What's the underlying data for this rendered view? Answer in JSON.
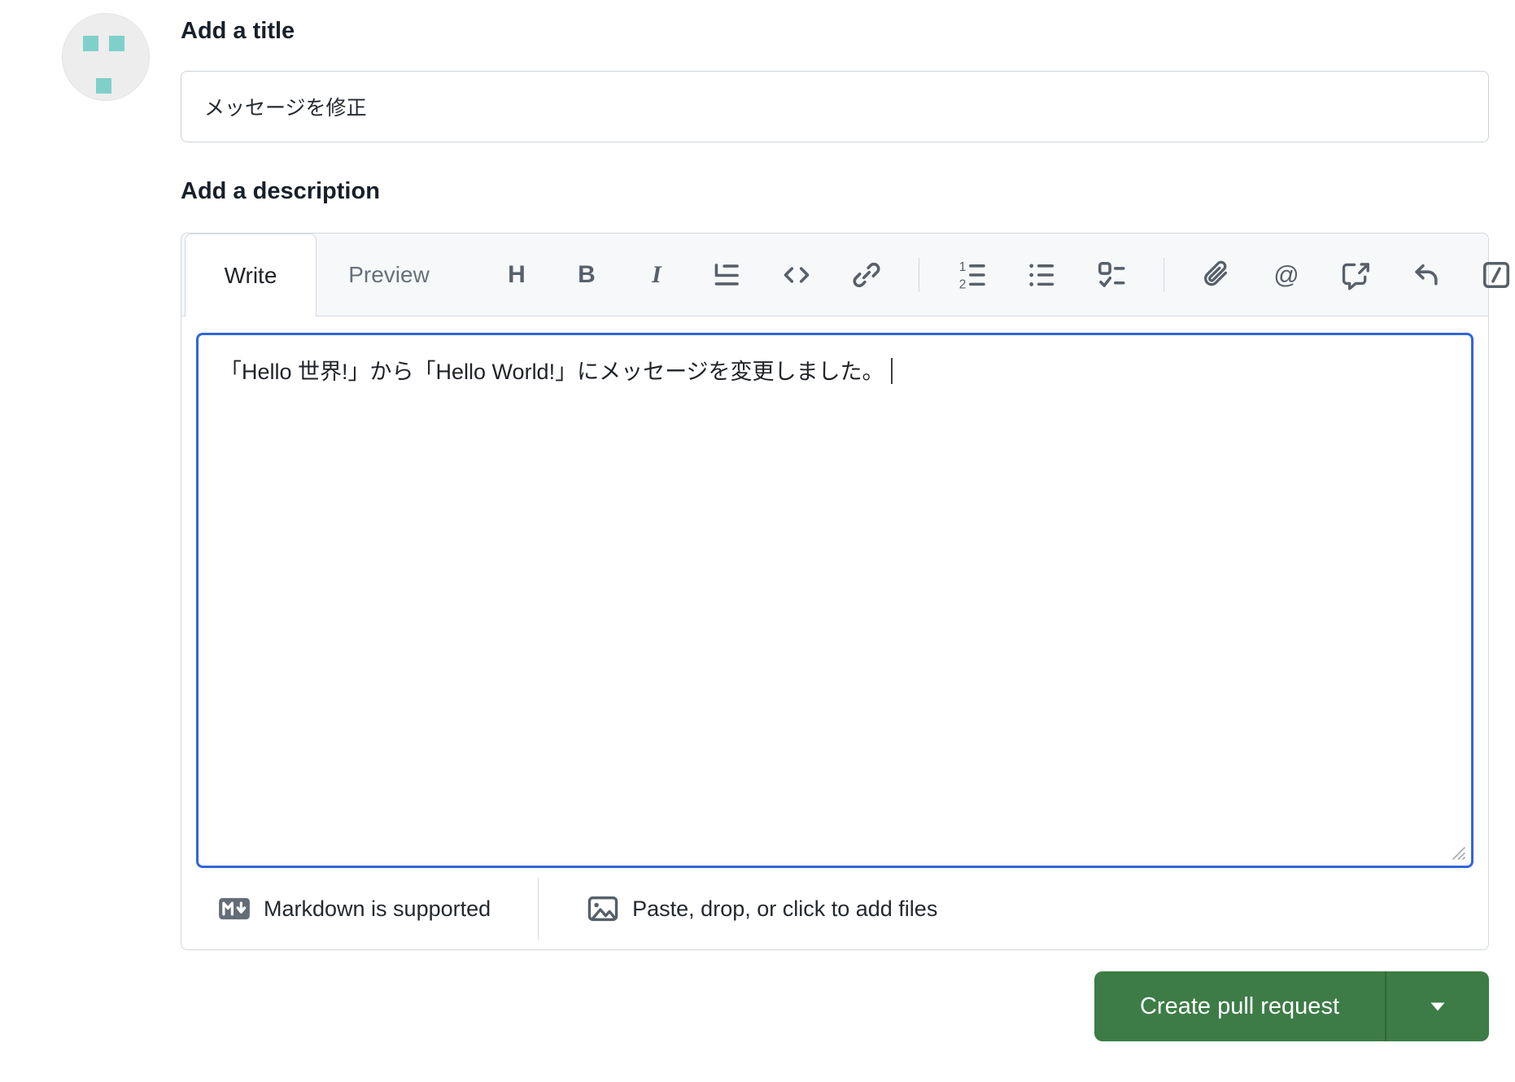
{
  "avatar": {
    "teal": "#7fd0ca"
  },
  "title_section": {
    "label": "Add a title",
    "value": "メッセージを修正"
  },
  "description_section": {
    "label": "Add a description",
    "tabs": {
      "write": "Write",
      "preview": "Preview"
    },
    "toolbar_icons": [
      "heading-icon",
      "bold-icon",
      "italic-icon",
      "quote-icon",
      "code-icon",
      "link-icon",
      "ordered-list-icon",
      "unordered-list-icon",
      "tasklist-icon",
      "paperclip-icon",
      "mention-icon",
      "cross-reference-icon",
      "reply-icon",
      "slash-command-icon"
    ],
    "glyphs": {
      "heading": "H",
      "bold": "B",
      "italic": "I",
      "mention": "@"
    },
    "body_text": "「Hello 世界!」から「Hello World!」にメッセージを変更しました。",
    "footer": {
      "markdown_note": "Markdown is supported",
      "paste_note": "Paste, drop, or click to add files"
    }
  },
  "actions": {
    "create_label": "Create pull request"
  },
  "colors": {
    "button_green": "#3d7c46",
    "focus_blue": "#3166d8",
    "icon_gray": "#57606a"
  }
}
